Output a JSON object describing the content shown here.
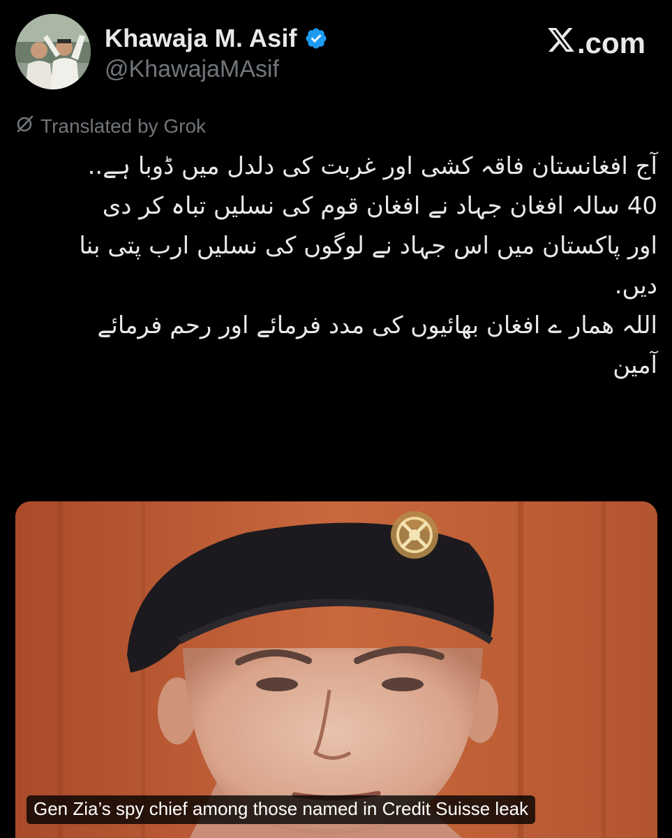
{
  "author": {
    "display_name": "Khawaja M. Asif",
    "handle": "@KhawajaMAsif",
    "verified": true,
    "verified_color": "#1d9bf0",
    "avatar_icon": "profile-photo-icon"
  },
  "brand": {
    "label": ".com",
    "logo_icon": "x-logo-icon"
  },
  "translation": {
    "label": "Translated by Grok",
    "icon": "grok-icon"
  },
  "tweet": {
    "lines": [
      "آج افغانستان فاقہ کشی اور غربت کی دلدل میں ڈوبا ہے..",
      "40 سالہ افغان جہاد نے افغان قوم کی نسلیں تباہ کر دی",
      "اور پاکستان میں اس جہاد نے لوگوں کی نسلیں ارب پتی بنا",
      "دیں.",
      "اللہ همار ے افغان بھائیوں کی مدد فرمائے اور رحم فرمائے",
      "آمین"
    ]
  },
  "media": {
    "caption": "Gen Zia’s spy chief among those named in Credit Suisse leak",
    "background_color": "#b65a33"
  },
  "colors": {
    "background": "#000000",
    "text_primary": "#e7e9ea",
    "text_secondary": "#71767b"
  }
}
